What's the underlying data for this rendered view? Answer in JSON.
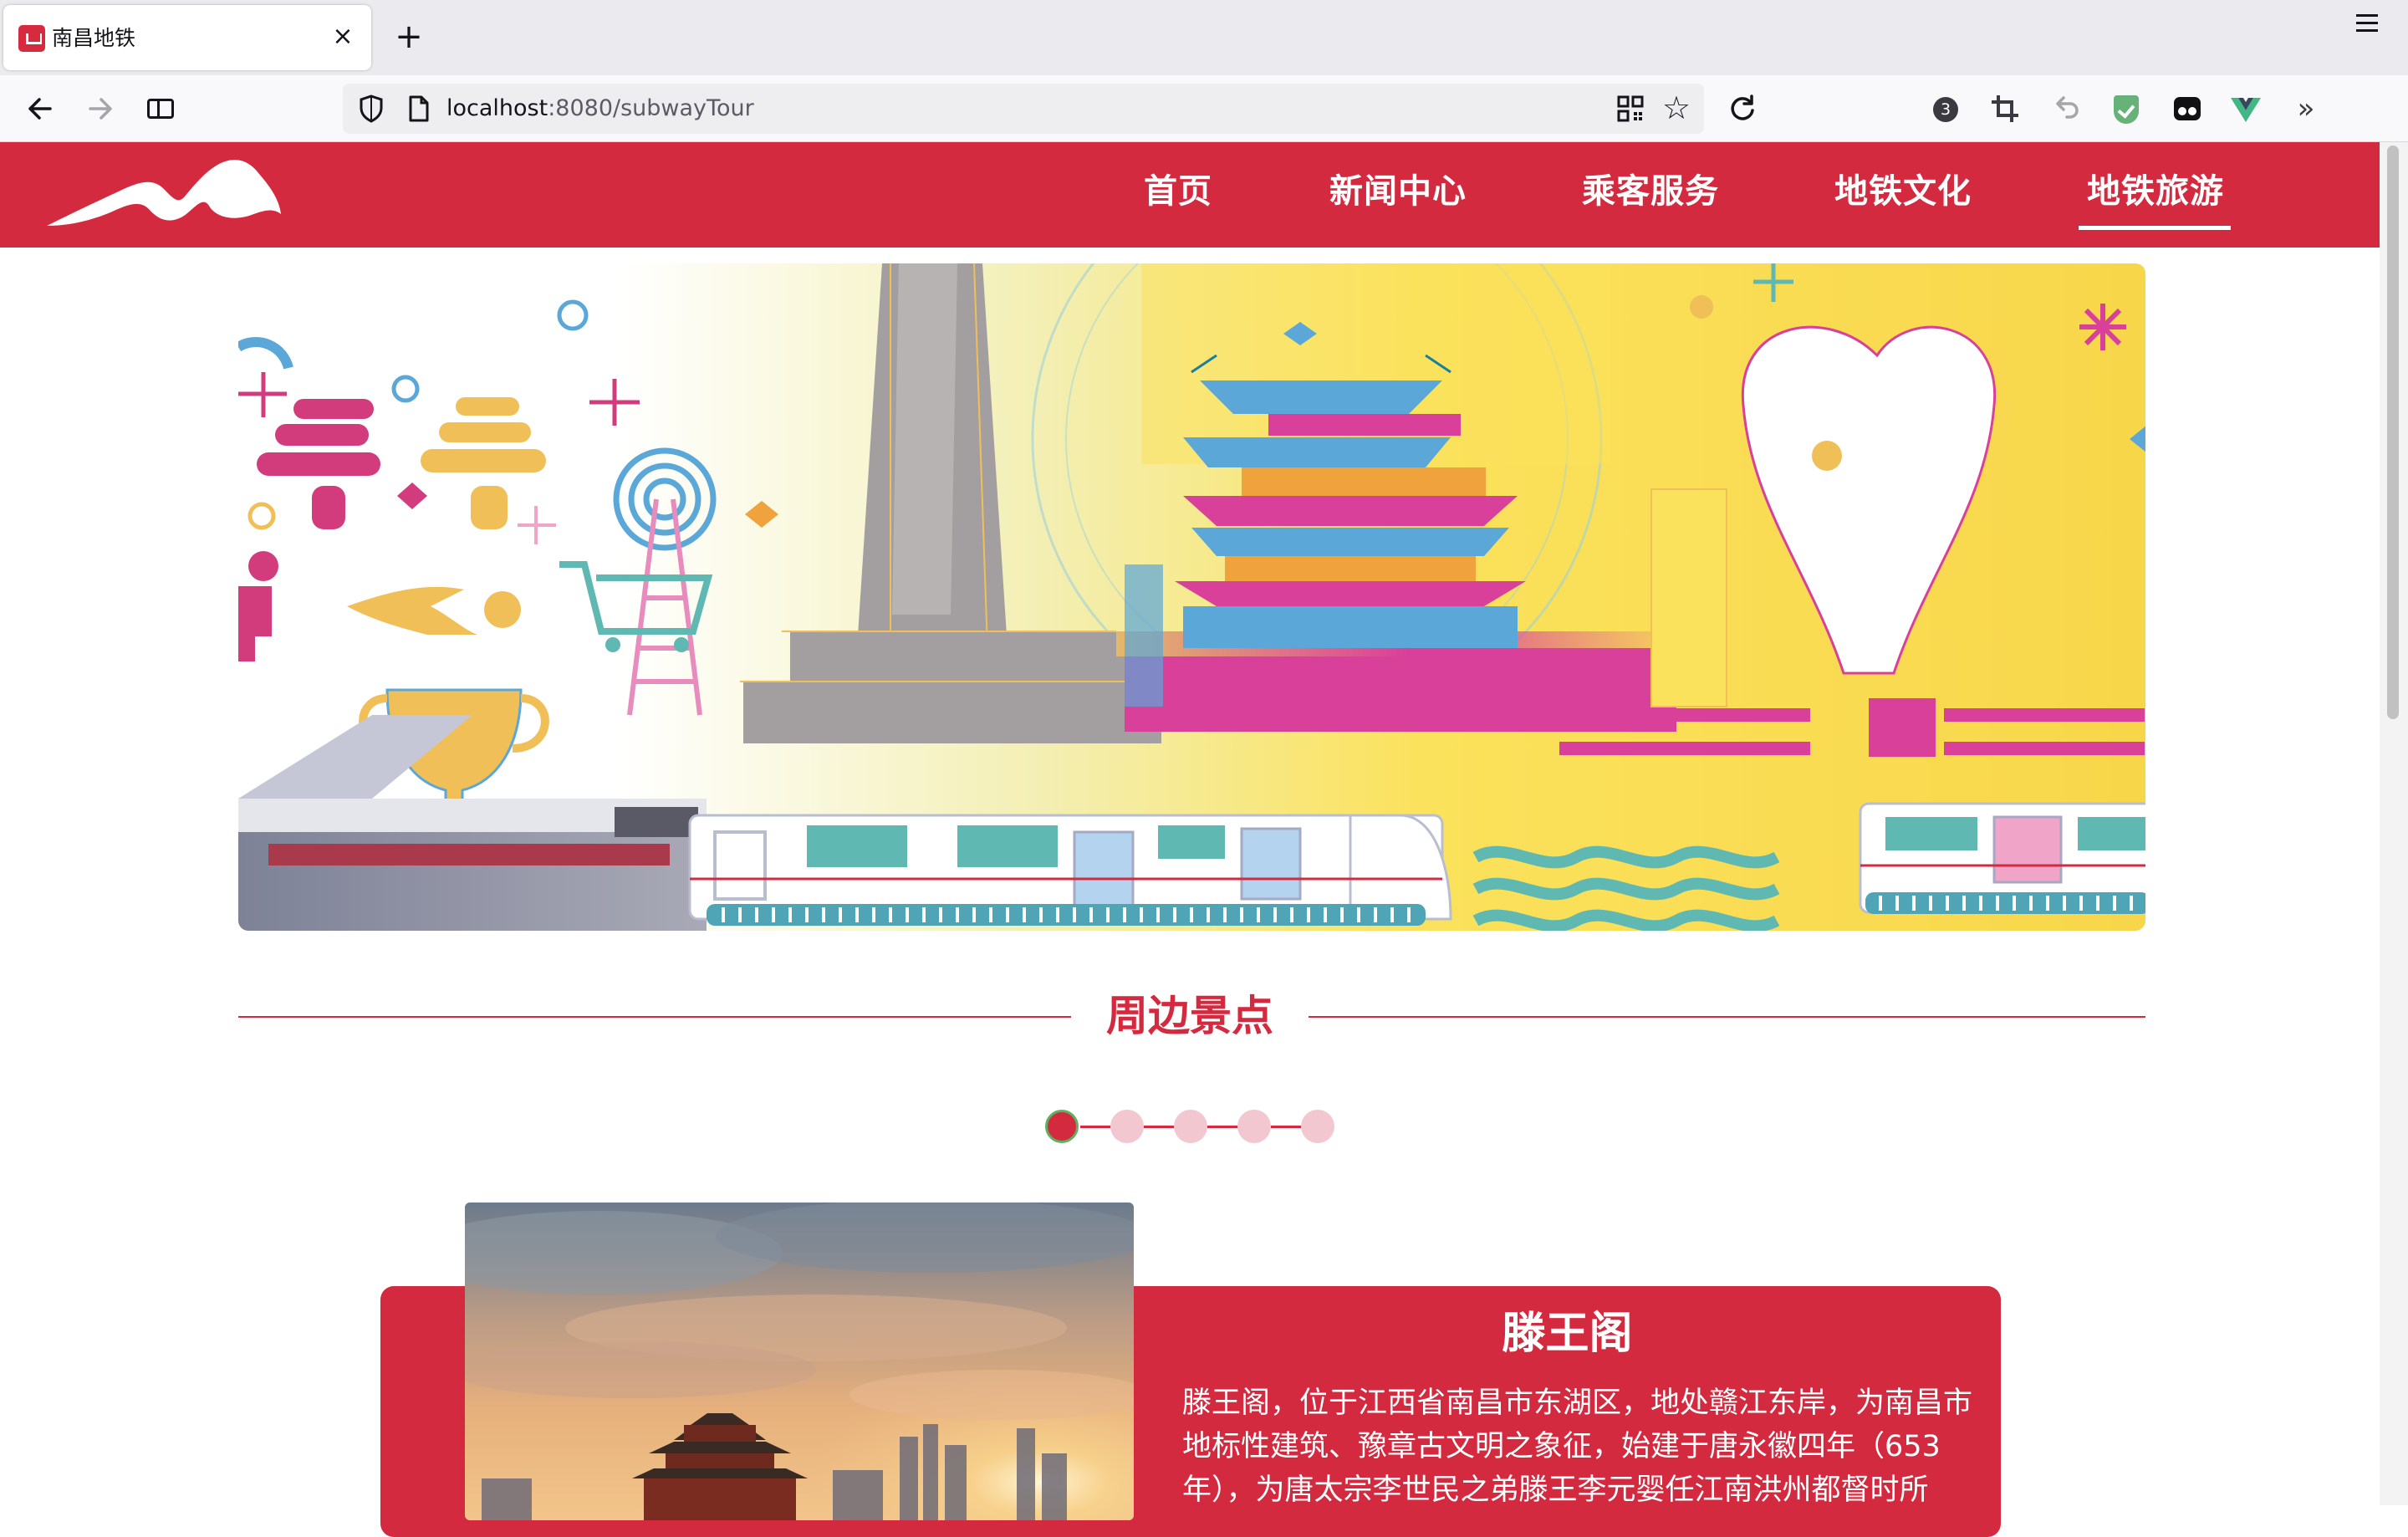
{
  "browser": {
    "tab_title": "南昌地铁",
    "tab_close": "×",
    "new_tab": "+",
    "url_host": "localhost",
    "url_path": ":8080/subwayTour",
    "ext_badge_count": "3",
    "icons": [
      "back-icon",
      "forward-icon",
      "reader-view-icon",
      "shield-icon",
      "page-icon",
      "qr-code-icon",
      "bookmark-star-icon",
      "reload-icon",
      "crop-icon",
      "undo-icon",
      "adguard-icon",
      "tampermonkey-icon",
      "vue-devtools-icon",
      "overflow-icon",
      "menu-icon"
    ]
  },
  "site": {
    "nav": [
      {
        "label": "首页"
      },
      {
        "label": "新闻中心"
      },
      {
        "label": "乘客服务"
      },
      {
        "label": "地铁文化"
      },
      {
        "label": "地铁旅游",
        "active": true
      }
    ],
    "accent_color": "#d42a3f"
  },
  "section": {
    "title": "周边景点",
    "dots": {
      "count": 5,
      "active_index": 0
    }
  },
  "attraction": {
    "title": "滕王阁",
    "description_lines": [
      "滕王阁，位于江西省南昌市东湖区，地处赣江东岸，为南昌市",
      "地标性建筑、豫章古文明之象征，始建于唐永徽四年（653",
      "年），为唐太宗李世民之弟滕王李元婴任江南洪州都督时所"
    ]
  }
}
